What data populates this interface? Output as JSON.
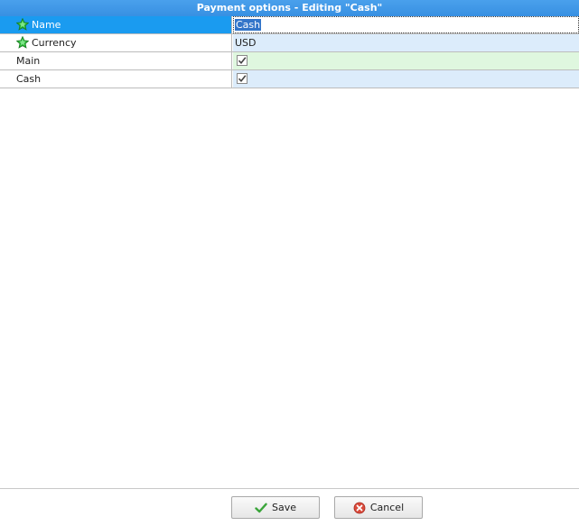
{
  "window": {
    "title": "Payment options - Editing \"Cash\""
  },
  "fields": [
    {
      "label": "Name",
      "value": "Cash",
      "required": true,
      "type": "text",
      "selected": true
    },
    {
      "label": "Currency",
      "value": "USD",
      "required": true,
      "type": "text"
    },
    {
      "label": "Main",
      "checked": true,
      "type": "checkbox"
    },
    {
      "label": "Cash",
      "checked": true,
      "type": "checkbox"
    }
  ],
  "buttons": {
    "save_label": "Save",
    "cancel_label": "Cancel"
  },
  "icons": {
    "required": "star-icon",
    "save": "checkmark-icon",
    "cancel": "cancel-icon"
  },
  "colors": {
    "title_bar": "#3b93e4",
    "selected_row": "#1a9bf0",
    "value_blue": "#dcecfb",
    "value_green": "#dff7df",
    "star_green": "#2fbf3a"
  }
}
